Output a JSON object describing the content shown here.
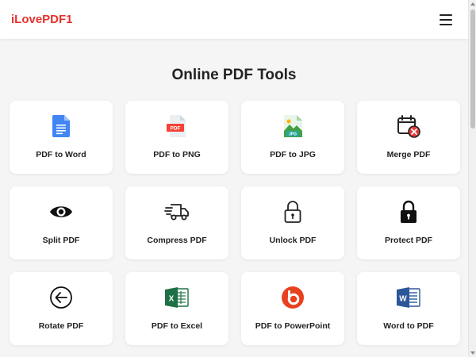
{
  "header": {
    "brand": "iLovePDF1",
    "menu_icon": "hamburger-menu-icon"
  },
  "main": {
    "title": "Online PDF Tools"
  },
  "tools": [
    {
      "label": "PDF to Word",
      "icon": "google-docs-icon"
    },
    {
      "label": "PDF to PNG",
      "icon": "pdf-file-icon"
    },
    {
      "label": "PDF to JPG",
      "icon": "jpg-image-file-icon"
    },
    {
      "label": "Merge PDF",
      "icon": "calendar-remove-icon"
    },
    {
      "label": "Split PDF",
      "icon": "eye-icon"
    },
    {
      "label": "Compress PDF",
      "icon": "delivery-truck-icon"
    },
    {
      "label": "Unlock PDF",
      "icon": "unlock-icon"
    },
    {
      "label": "Protect PDF",
      "icon": "lock-icon"
    },
    {
      "label": "Rotate PDF",
      "icon": "arrow-left-circle-icon"
    },
    {
      "label": "PDF to Excel",
      "icon": "excel-icon"
    },
    {
      "label": "PDF to PowerPoint",
      "icon": "beats-circle-icon"
    },
    {
      "label": "Word to PDF",
      "icon": "word-icon"
    }
  ],
  "colors": {
    "brand": "#e5322d",
    "background": "#f5f5f5",
    "card": "#ffffff"
  }
}
